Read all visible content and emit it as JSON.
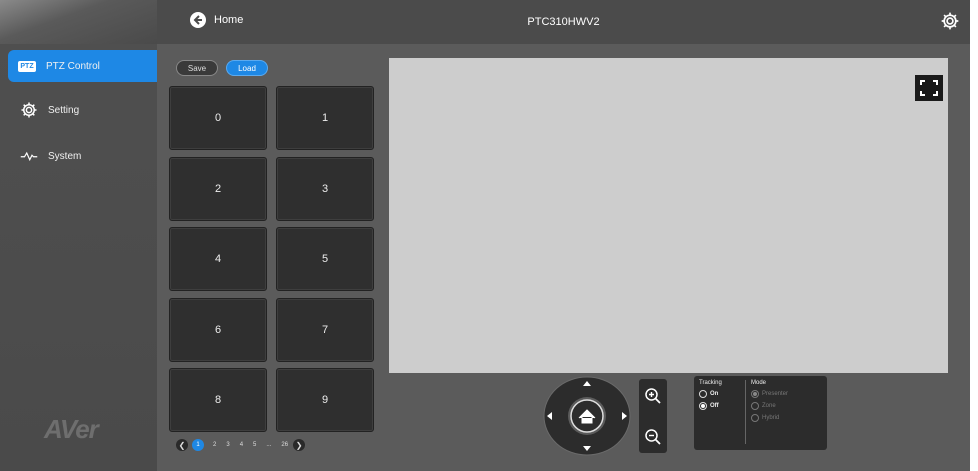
{
  "header": {
    "home_label": "Home",
    "device_name": "PTC310HWV2"
  },
  "sidebar": {
    "brand": "AVer",
    "items": [
      {
        "label": "PTZ Control",
        "icon": "ptz-icon",
        "badge": "PTZ",
        "active": true
      },
      {
        "label": "Setting",
        "icon": "gear-icon",
        "active": false
      },
      {
        "label": "System",
        "icon": "pulse-icon",
        "active": false
      }
    ]
  },
  "presets": {
    "save_label": "Save",
    "load_label": "Load",
    "buttons": [
      "0",
      "1",
      "2",
      "3",
      "4",
      "5",
      "6",
      "7",
      "8",
      "9"
    ]
  },
  "pagination": {
    "pages": [
      "1",
      "2",
      "3",
      "4",
      "5",
      "...",
      "26"
    ],
    "current": "1"
  },
  "tracking": {
    "title": "Tracking",
    "options": [
      "On",
      "Off"
    ],
    "selected": "Off"
  },
  "mode": {
    "title": "Mode",
    "options": [
      "Presenter",
      "Zone",
      "Hybrid"
    ],
    "selected": "Presenter",
    "enabled": false
  },
  "colors": {
    "accent": "#1e88e5",
    "sidebar_bg": "#4a4a4a",
    "content_bg": "#5b5b5b",
    "preset_bg": "#2f2f2f",
    "preview_bg": "#cdcdcd"
  }
}
